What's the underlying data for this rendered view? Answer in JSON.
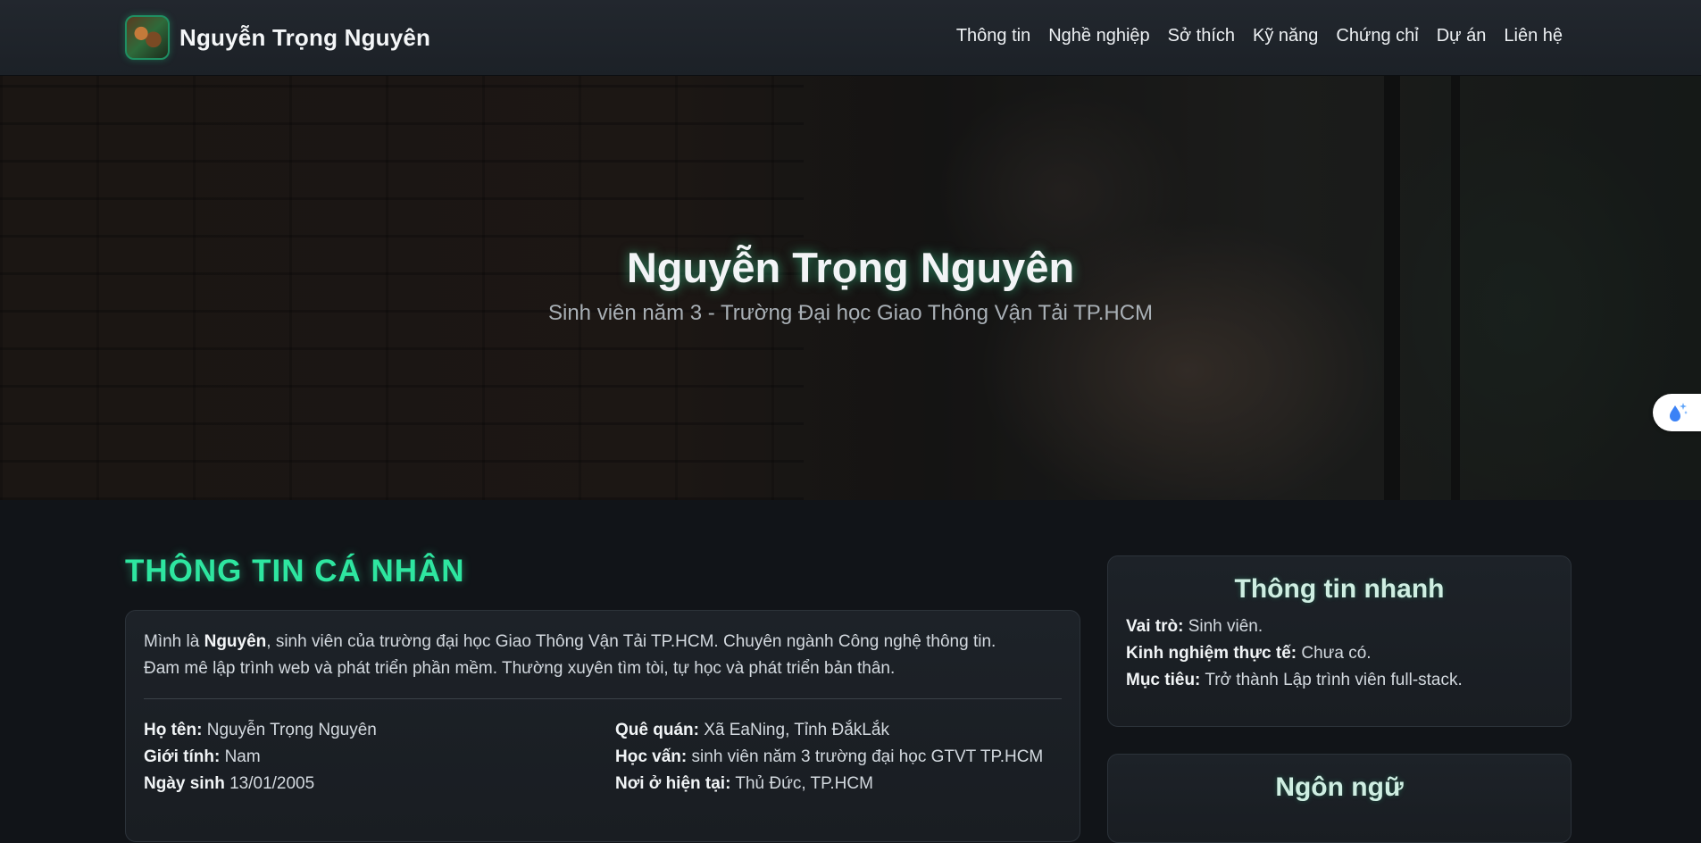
{
  "navbar": {
    "brand_name": "Nguyễn Trọng Nguyên",
    "links": [
      "Thông tin",
      "Nghề nghiệp",
      "Sở thích",
      "Kỹ năng",
      "Chứng chỉ",
      "Dự án",
      "Liên hệ"
    ]
  },
  "hero": {
    "title": "Nguyễn Trọng Nguyên",
    "subtitle": "Sinh viên năm 3 - Trường Đại học Giao Thông Vận Tải TP.HCM"
  },
  "about": {
    "section_title": "THÔNG TIN CÁ NHÂN",
    "intro_prefix": "Mình là ",
    "intro_name": "Nguyên",
    "intro_line1_rest": ", sinh viên của trường đại học Giao Thông Vận Tải TP.HCM. Chuyên ngành Công nghệ thông tin.",
    "intro_line2": "Đam mê lập trình web và phát triển phần mềm. Thường xuyên tìm tòi, tự học và phát triển bản thân.",
    "fields": {
      "full_name": {
        "label": "Họ tên:",
        "value": "Nguyễn Trọng Nguyên"
      },
      "hometown": {
        "label": "Quê quán:",
        "value": "Xã EaNing, Tỉnh ĐắkLắk"
      },
      "gender": {
        "label": "Giới tính:",
        "value": "Nam"
      },
      "education": {
        "label": "Học vấn:",
        "value": "sinh viên năm 3 trường đại học GTVT TP.HCM"
      },
      "birthday": {
        "label": "Ngày sinh",
        "value": "13/01/2005"
      },
      "residence": {
        "label": "Nơi ở hiện tại:",
        "value": "Thủ Đức, TP.HCM"
      }
    }
  },
  "quick_info": {
    "title": "Thông tin nhanh",
    "role": {
      "label": "Vai trò:",
      "value": "Sinh viên."
    },
    "experience": {
      "label": "Kinh nghiệm thực tế:",
      "value": "Chưa có."
    },
    "goal": {
      "label": "Mục tiêu:",
      "value": "Trở thành Lập trình viên full-stack."
    }
  },
  "languages": {
    "title": "Ngôn ngữ"
  },
  "theme": {
    "accent": "#2ee6a0",
    "background": "#111418",
    "card_background": "#1b2025"
  },
  "floating_button": {
    "icon": "water-drop-sparkle-icon"
  }
}
